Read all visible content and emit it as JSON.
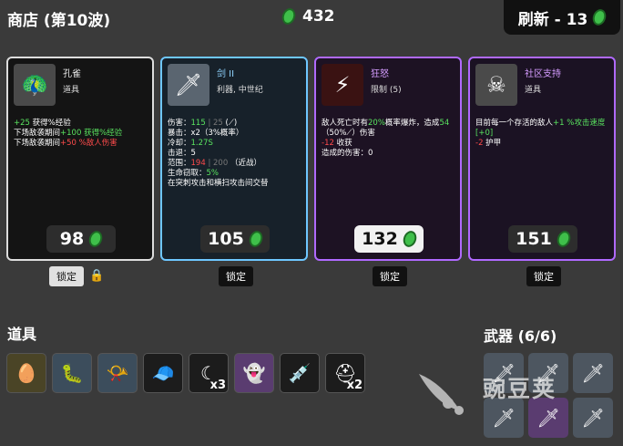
{
  "header": {
    "title": "商店 (第10波)",
    "materials": "432",
    "reroll_label": "刷新 - 13"
  },
  "cards": [
    {
      "name": "孔雀",
      "type": "道具",
      "icon": "peacock-icon",
      "desc": [
        [
          {
            "t": "+25",
            "c": "g"
          },
          {
            "t": " 获得%经验"
          }
        ],
        [
          {
            "t": "下场敌袭期间"
          },
          {
            "t": "+100 获得%经验",
            "c": "g"
          }
        ],
        [
          {
            "t": "下场敌袭期间"
          },
          {
            "t": "+50 %敌人伤害",
            "c": "r"
          }
        ]
      ],
      "price": "98",
      "lock": "锁定",
      "locked": true
    },
    {
      "name": "剑 II",
      "type": "利器, 中世纪",
      "icon": "sword-icon",
      "desc": [
        [
          {
            "t": "伤害："
          },
          {
            "t": "115",
            "c": "g"
          },
          {
            "t": " | 25 ",
            "c": "gy"
          },
          {
            "t": "(⟋)"
          }
        ],
        [
          {
            "t": "暴击：x2（3%概率）"
          }
        ],
        [
          {
            "t": "冷却："
          },
          {
            "t": "1.27S",
            "c": "g"
          }
        ],
        [
          {
            "t": "击退：5"
          }
        ],
        [
          {
            "t": "范围："
          },
          {
            "t": "194",
            "c": "r"
          },
          {
            "t": " | 200 ",
            "c": "gy"
          },
          {
            "t": "（近战）"
          }
        ],
        [
          {
            "t": "生命窃取："
          },
          {
            "t": "5%",
            "c": "g"
          }
        ],
        [
          {
            "t": "在突刺攻击和横扫攻击间交替"
          }
        ]
      ],
      "price": "105",
      "lock": "锁定",
      "locked": false
    },
    {
      "name": "狂怒",
      "type": "限制 (5)",
      "icon": "fury-icon",
      "desc": [
        [
          {
            "t": "敌人死亡时有"
          },
          {
            "t": "20%",
            "c": "g"
          },
          {
            "t": "概率爆炸，造成"
          },
          {
            "t": "54",
            "c": "g"
          }
        ],
        [
          {
            "t": "（50%⟋）伤害"
          }
        ],
        [
          {
            "t": "-12",
            "c": "r"
          },
          {
            "t": " 收获"
          }
        ],
        [
          {
            "t": "造成的伤害：0"
          }
        ]
      ],
      "price": "132",
      "lock": "锁定",
      "locked": false
    },
    {
      "name": "社区支持",
      "type": "道具",
      "icon": "community-icon",
      "desc": [
        [
          {
            "t": "目前每一个存活的敌人"
          },
          {
            "t": "+1 %攻击速度",
            "c": "g"
          }
        ],
        [
          {
            "t": "[+0]",
            "c": "g"
          }
        ],
        [
          {
            "t": "-2",
            "c": "r"
          },
          {
            "t": " 护甲"
          }
        ]
      ],
      "price": "151",
      "lock": "锁定",
      "locked": false
    }
  ],
  "items_section": {
    "title": "道具"
  },
  "items": [
    {
      "icon": "egg-icon",
      "qty": "",
      "bg": "#4a4426"
    },
    {
      "icon": "worm-icon",
      "qty": "",
      "bg": "#3c4d5c"
    },
    {
      "icon": "horn-icon",
      "qty": "",
      "bg": "#3c4d5c"
    },
    {
      "icon": "propeller-hat-icon",
      "qty": "",
      "bg": "#1c1c1c"
    },
    {
      "icon": "scythe-icon",
      "qty": "x3",
      "bg": "#1c1c1c"
    },
    {
      "icon": "ghost-icon",
      "qty": "",
      "bg": "#5a3c70"
    },
    {
      "icon": "syringe-icon",
      "qty": "",
      "bg": "#1c1c1c"
    },
    {
      "icon": "helmet-icon",
      "qty": "x2",
      "bg": "#1c1c1c"
    }
  ],
  "weapons_section": {
    "title": "武器 (6/6)"
  },
  "weapons": [
    {
      "icon": "sword-icon",
      "purple": false
    },
    {
      "icon": "sword-icon",
      "purple": false
    },
    {
      "icon": "sword-icon",
      "purple": false
    },
    {
      "icon": "sword-icon",
      "purple": false
    },
    {
      "icon": "sword-icon",
      "purple": true
    },
    {
      "icon": "sword-icon",
      "purple": false
    }
  ],
  "watermark": {
    "text": "豌豆荚"
  }
}
